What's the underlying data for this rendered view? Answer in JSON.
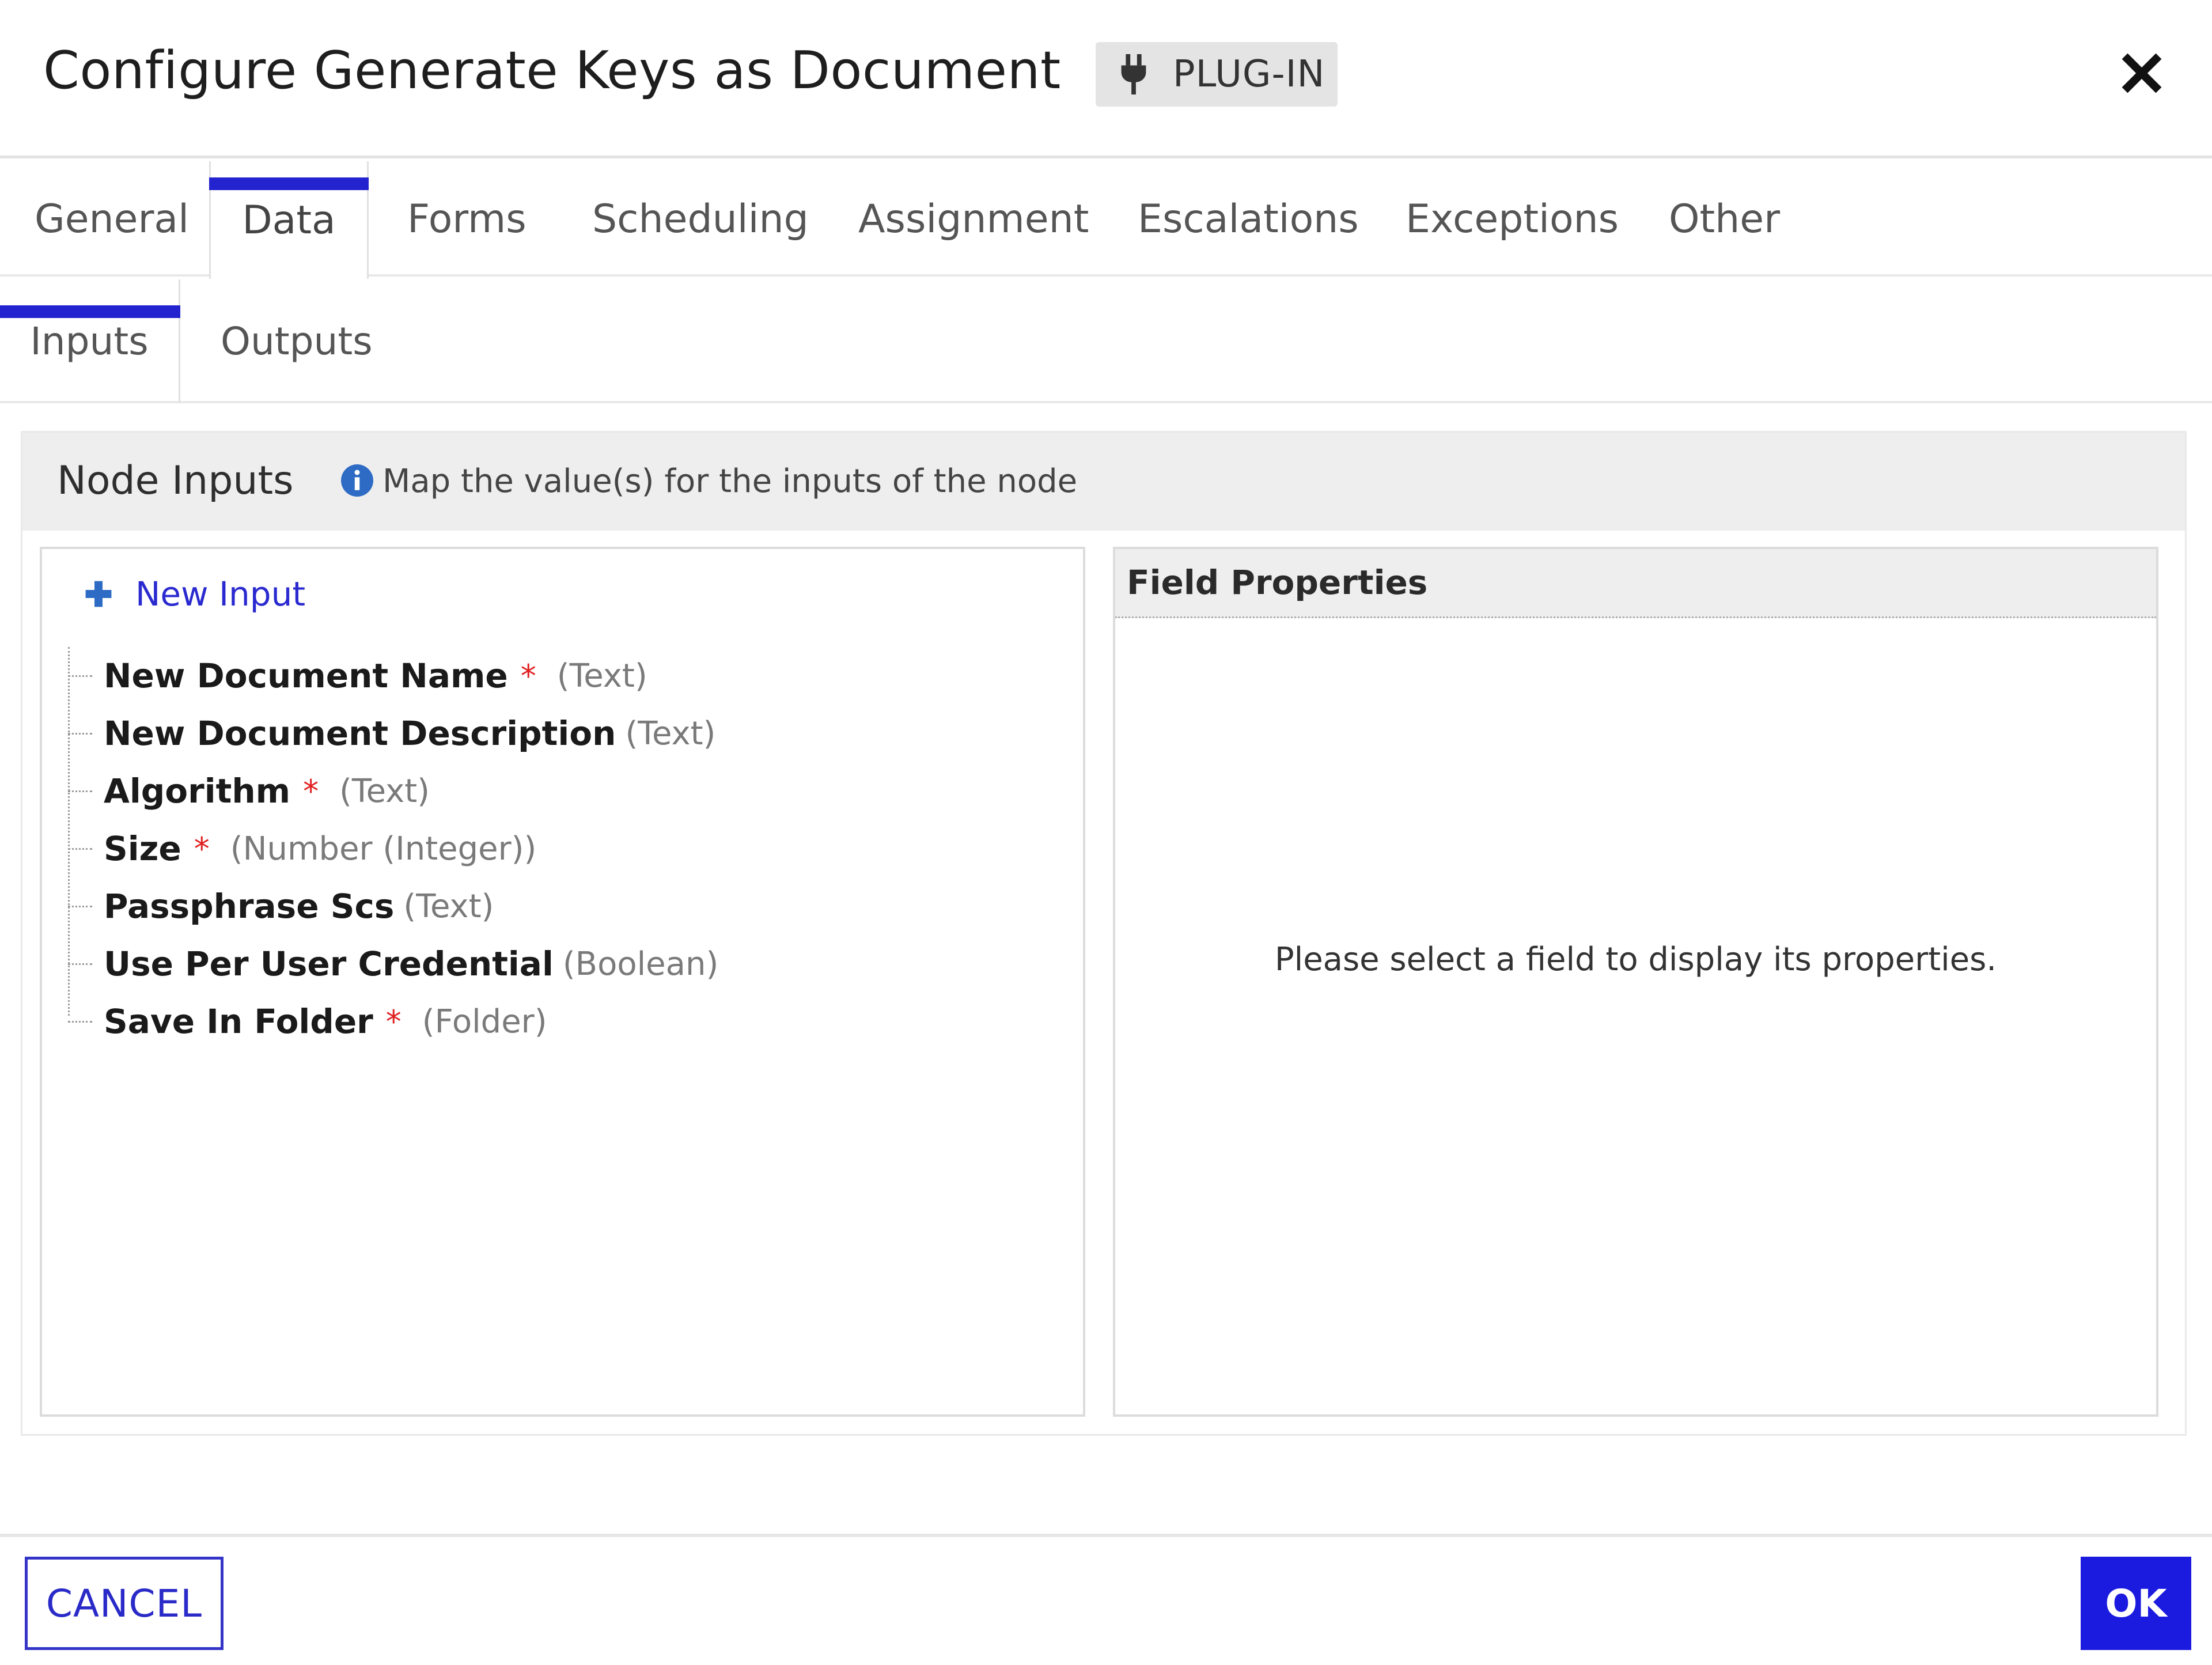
{
  "dialog": {
    "title": "Configure Generate Keys as Document",
    "badge": "PLUG-IN",
    "close_icon": "close-icon"
  },
  "tabs": [
    {
      "label": "General",
      "active": false
    },
    {
      "label": "Data",
      "active": true
    },
    {
      "label": "Forms",
      "active": false
    },
    {
      "label": "Scheduling",
      "active": false
    },
    {
      "label": "Assignment",
      "active": false
    },
    {
      "label": "Escalations",
      "active": false
    },
    {
      "label": "Exceptions",
      "active": false
    },
    {
      "label": "Other",
      "active": false
    }
  ],
  "subtabs": [
    {
      "label": "Inputs",
      "active": true
    },
    {
      "label": "Outputs",
      "active": false
    }
  ],
  "node_inputs": {
    "title": "Node Inputs",
    "hint": "Map the value(s) for the inputs of the node",
    "new_input_label": "New Input",
    "required_marker": "*",
    "fields": [
      {
        "name": "New Document Name",
        "required": true,
        "type": "(Text)"
      },
      {
        "name": "New Document Description",
        "required": false,
        "type": "(Text)"
      },
      {
        "name": "Algorithm",
        "required": true,
        "type": "(Text)"
      },
      {
        "name": "Size",
        "required": true,
        "type": "(Number (Integer))"
      },
      {
        "name": "Passphrase Scs",
        "required": false,
        "type": "(Text)"
      },
      {
        "name": "Use Per User Credential",
        "required": false,
        "type": "(Boolean)"
      },
      {
        "name": "Save In Folder",
        "required": true,
        "type": "(Folder)"
      }
    ]
  },
  "field_properties": {
    "title": "Field Properties",
    "empty_message": "Please select a field to display its properties."
  },
  "footer": {
    "cancel_label": "CANCEL",
    "ok_label": "OK"
  },
  "colors": {
    "accent": "#2323cf",
    "ok_button": "#1b1be0",
    "required": "#e02020"
  }
}
